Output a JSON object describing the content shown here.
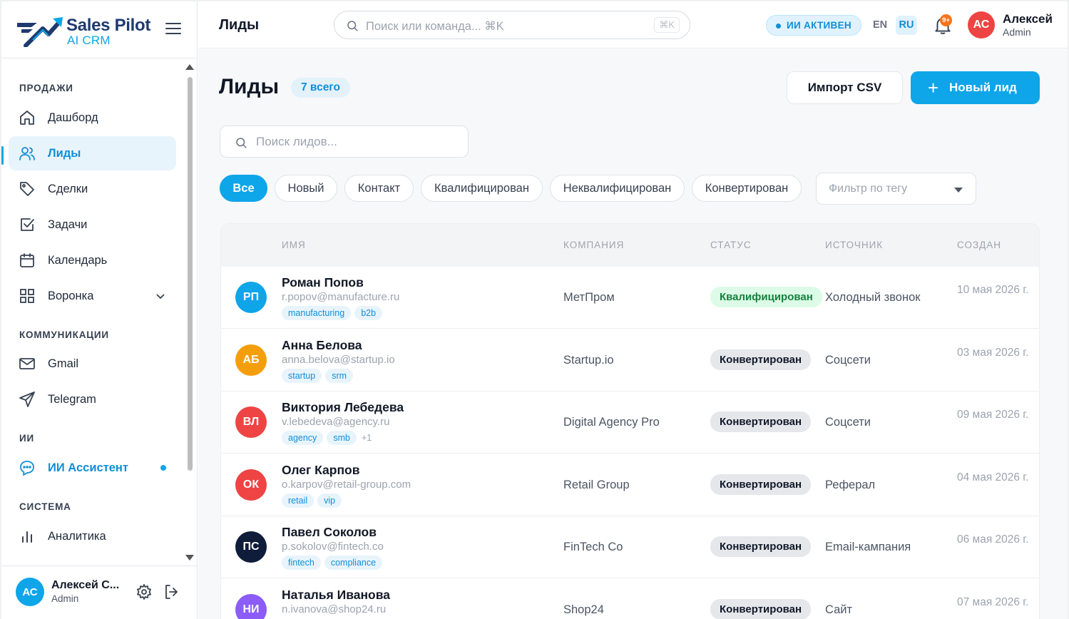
{
  "brand": {
    "title": "Sales Pilot",
    "subtitle": "AI CRM"
  },
  "sidebar": {
    "sections": [
      "ПРОДАЖИ",
      "КОММУНИКАЦИИ",
      "ИИ",
      "СИСТЕМА"
    ],
    "items": [
      {
        "label": "Дашборд",
        "icon": "home-icon"
      },
      {
        "label": "Лиды",
        "icon": "users-icon",
        "active": true
      },
      {
        "label": "Сделки",
        "icon": "tag-icon"
      },
      {
        "label": "Задачи",
        "icon": "checkbox-icon"
      },
      {
        "label": "Календарь",
        "icon": "calendar-icon"
      },
      {
        "label": "Воронка",
        "icon": "grid-icon"
      },
      {
        "label": "Gmail",
        "icon": "mail-icon"
      },
      {
        "label": "Telegram",
        "icon": "send-icon"
      },
      {
        "label": "ИИ Ассистент",
        "icon": "chat-bubble-icon"
      },
      {
        "label": "Аналитика",
        "icon": "bar-chart-icon"
      }
    ],
    "user": {
      "initials": "АС",
      "name": "Алексей С...",
      "role": "Admin"
    }
  },
  "header": {
    "title": "Лиды",
    "search_placeholder": "Поиск или команда... ⌘K",
    "shortcut": "⌘K",
    "ai_status": "ИИ АКТИВЕН",
    "lang_en": "EN",
    "lang_ru": "RU",
    "notifications": "9+",
    "user": {
      "initials": "АС",
      "name": "Алексей",
      "role": "Admin"
    }
  },
  "main": {
    "title": "Лиды",
    "count": "7 всего",
    "import_label": "Импорт CSV",
    "new_lead_label": "Новый лид",
    "search_placeholder": "Поиск лидов...",
    "filters": [
      "Все",
      "Новый",
      "Контакт",
      "Квалифицирован",
      "Неквалифицирован",
      "Конвертирован"
    ],
    "tag_filter_placeholder": "Фильтр по тегу",
    "columns": [
      "ИМЯ",
      "КОМПАНИЯ",
      "СТАТУС",
      "ИСТОЧНИК",
      "СОЗДАН"
    ],
    "rows": [
      {
        "initials": "РП",
        "color": "#0ea5e9",
        "name": "Роман Попов",
        "email": "r.popov@manufacture.ru",
        "tags": [
          "manufacturing",
          "b2b"
        ],
        "more": "",
        "company": "МетПром",
        "status": "Квалифицирован",
        "source": "Холодный звонок",
        "date": "10 мая 2026 г."
      },
      {
        "initials": "АБ",
        "color": "#f59e0b",
        "name": "Анна Белова",
        "email": "anna.belova@startup.io",
        "tags": [
          "startup",
          "srm"
        ],
        "more": "",
        "company": "Startup.io",
        "status": "Конвертирован",
        "source": "Соцсети",
        "date": "03 мая 2026 г."
      },
      {
        "initials": "ВЛ",
        "color": "#ef4444",
        "name": "Виктория Лебедева",
        "email": "v.lebedeva@agency.ru",
        "tags": [
          "agency",
          "smb"
        ],
        "more": "+1",
        "company": "Digital Agency Pro",
        "status": "Конвертирован",
        "source": "Соцсети",
        "date": "09 мая 2026 г."
      },
      {
        "initials": "ОК",
        "color": "#ef4444",
        "name": "Олег Карпов",
        "email": "o.karpov@retail-group.com",
        "tags": [
          "retail",
          "vip"
        ],
        "more": "",
        "company": "Retail Group",
        "status": "Конвертирован",
        "source": "Реферал",
        "date": "04 мая 2026 г."
      },
      {
        "initials": "ПС",
        "color": "#0f1d3a",
        "name": "Павел Соколов",
        "email": "p.sokolov@fintech.co",
        "tags": [
          "fintech",
          "compliance"
        ],
        "more": "",
        "company": "FinTech Co",
        "status": "Конвертирован",
        "source": "Email-кампания",
        "date": "06 мая 2026 г."
      },
      {
        "initials": "НИ",
        "color": "#8b5cf6",
        "name": "Наталья Иванова",
        "email": "n.ivanova@shop24.ru",
        "tags": [],
        "more": "",
        "company": "Shop24",
        "status": "Конвертирован",
        "source": "Сайт",
        "date": "07 мая 2026 г."
      }
    ]
  },
  "colors": {
    "accent": "#0ea5e9",
    "brand": "#1e3a6e",
    "qualified_bg": "#dcfce7",
    "qualified_text": "#15803d"
  }
}
